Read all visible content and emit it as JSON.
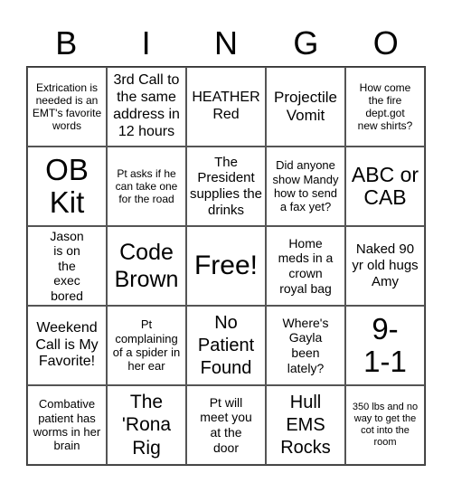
{
  "header": [
    "B",
    "I",
    "N",
    "G",
    "O"
  ],
  "cells": [
    "Extrication is needed is an EMT's favorite words",
    "3rd Call to the same address in 12 hours",
    "HEATHER Red",
    "Projectile Vomit",
    "How come the fire dept.got new shirts?",
    "OB Kit",
    "Pt asks if he can take one for the road",
    "The President supplies the drinks",
    "Did anyone show Mandy how to send a fax yet?",
    "ABC or CAB",
    "Jason is on the exec bored",
    "Code Brown",
    "Free!",
    "Home meds in a crown royal bag",
    "Naked 90 yr old hugs Amy",
    "Weekend Call is My Favorite!",
    "Pt complaining of a spider in her ear",
    "No Patient Found",
    "Where's Gayla been lately?",
    "9-1-1",
    "Combative patient has worms in her brain",
    "The 'Rona Rig",
    "Pt will meet you at the door",
    "Hull EMS Rocks",
    "350 lbs and no way to get the cot into the room"
  ]
}
